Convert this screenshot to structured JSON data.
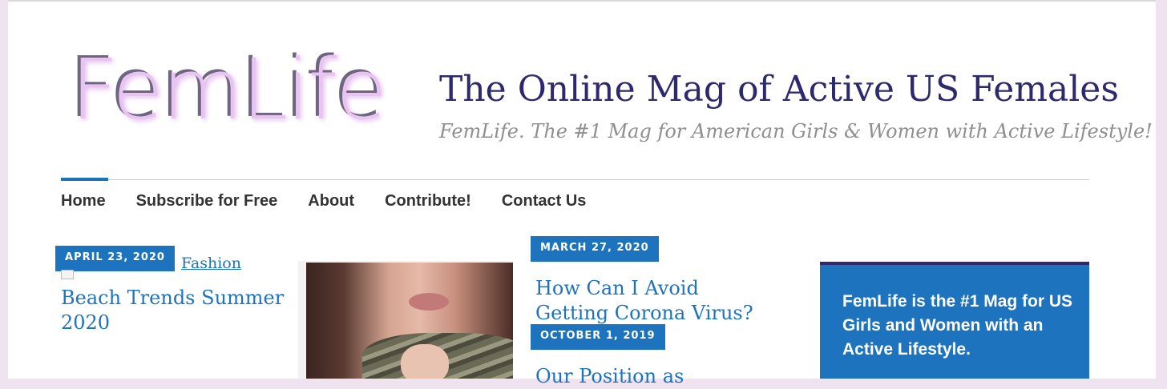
{
  "header": {
    "logo_text": "FemLife",
    "title": "The Online Mag of Active US Females",
    "tagline": "FemLife. The #1 Mag for American Girls & Women with Active Lifestyle!"
  },
  "nav": {
    "items": [
      "Home",
      "Subscribe for Free",
      "About",
      "Contribute!",
      "Contact Us"
    ],
    "active": "Home"
  },
  "posts": {
    "col1": {
      "date": "APRIL 23, 2020",
      "categories": "Fashion",
      "title": "Beach Trends Summer 2020"
    },
    "col3": [
      {
        "date": "MARCH 27, 2020",
        "title": "How Can I Avoid Getting Corona Virus?"
      },
      {
        "date": "OCTOBER 1, 2019",
        "title": "Our Position as"
      }
    ]
  },
  "sidebar": {
    "widget_text": "FemLife is the #1 Mag for US Girls and Women with an Active Lifestyle."
  },
  "colors": {
    "accent": "#1e73be",
    "title": "#2c2a6b",
    "nav_text": "#333333"
  }
}
